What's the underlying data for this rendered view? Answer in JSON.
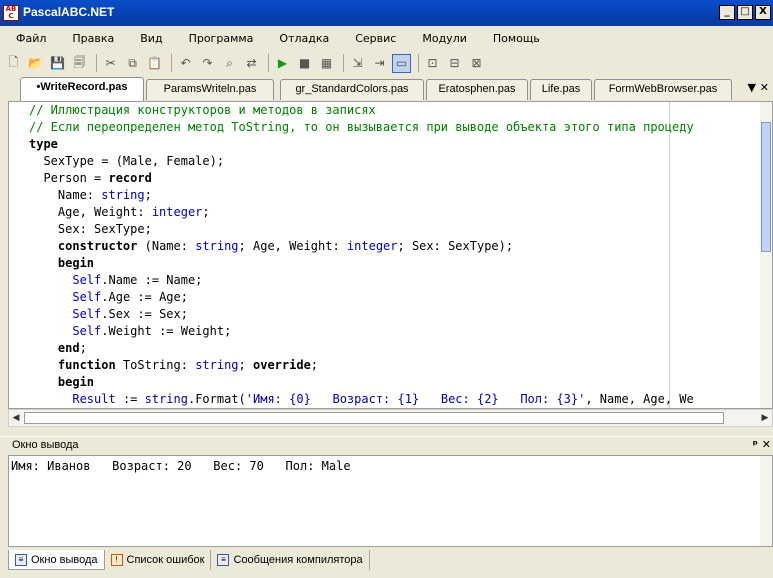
{
  "window": {
    "title": "PascalABC.NET",
    "icon_text": "AB\nC",
    "min": "_",
    "max": "□",
    "close": "X"
  },
  "menu": [
    "Файл",
    "Правка",
    "Вид",
    "Программа",
    "Отладка",
    "Сервис",
    "Модули",
    "Помощь"
  ],
  "toolbar_icons": [
    "new-file-icon",
    "open-folder-icon",
    "save-icon",
    "save-all-icon",
    "cut-icon",
    "copy-icon",
    "paste-icon",
    "undo-icon",
    "redo-icon",
    "find-icon",
    "replace-icon",
    "run-icon",
    "stop-icon",
    "compile-icon",
    "debug-step-icon",
    "debug-next-icon",
    "console-icon",
    "form-icon",
    "format-icon",
    "read-icon"
  ],
  "tabs": [
    {
      "label": "•WriteRecord.pas",
      "active": true
    },
    {
      "label": "ParamsWriteln.pas",
      "active": false
    },
    {
      "label": "gr_StandardColors.pas",
      "active": false
    },
    {
      "label": "Eratosphen.pas",
      "active": false
    },
    {
      "label": "Life.pas",
      "active": false
    },
    {
      "label": "FormWebBrowser.pas",
      "active": false
    }
  ],
  "tab_controls": "▼ ✕",
  "code": [
    [
      {
        "t": "// Иллюстрация конструкторов и методов в записях",
        "c": "com"
      }
    ],
    [
      {
        "t": "// Если переопределен метод ToString, то он вызывается при выводе объекта этого типа процеду",
        "c": "com"
      }
    ],
    [
      {
        "t": "type",
        "c": "kw"
      }
    ],
    [
      {
        "t": "  SexType = (Male, Female);",
        "c": ""
      }
    ],
    [
      {
        "t": "  Person = ",
        "c": ""
      },
      {
        "t": "record",
        "c": "kw"
      }
    ],
    [
      {
        "t": "    Name: ",
        "c": ""
      },
      {
        "t": "string",
        "c": "type"
      },
      {
        "t": ";",
        "c": ""
      }
    ],
    [
      {
        "t": "    Age, Weight: ",
        "c": ""
      },
      {
        "t": "integer",
        "c": "type"
      },
      {
        "t": ";",
        "c": ""
      }
    ],
    [
      {
        "t": "    Sex: SexType;",
        "c": ""
      }
    ],
    [
      {
        "t": "    ",
        "c": ""
      },
      {
        "t": "constructor",
        "c": "kw"
      },
      {
        "t": " (Name: ",
        "c": ""
      },
      {
        "t": "string",
        "c": "type"
      },
      {
        "t": "; Age, Weight: ",
        "c": ""
      },
      {
        "t": "integer",
        "c": "type"
      },
      {
        "t": "; Sex: SexType);",
        "c": ""
      }
    ],
    [
      {
        "t": "    ",
        "c": ""
      },
      {
        "t": "begin",
        "c": "kw"
      }
    ],
    [
      {
        "t": "      ",
        "c": ""
      },
      {
        "t": "Self",
        "c": "type"
      },
      {
        "t": ".Name := Name;",
        "c": ""
      }
    ],
    [
      {
        "t": "      ",
        "c": ""
      },
      {
        "t": "Self",
        "c": "type"
      },
      {
        "t": ".Age := Age;",
        "c": ""
      }
    ],
    [
      {
        "t": "      ",
        "c": ""
      },
      {
        "t": "Self",
        "c": "type"
      },
      {
        "t": ".Sex := Sex;",
        "c": ""
      }
    ],
    [
      {
        "t": "      ",
        "c": ""
      },
      {
        "t": "Self",
        "c": "type"
      },
      {
        "t": ".Weight := Weight;",
        "c": ""
      }
    ],
    [
      {
        "t": "    ",
        "c": ""
      },
      {
        "t": "end",
        "c": "kw"
      },
      {
        "t": ";",
        "c": ""
      }
    ],
    [
      {
        "t": "    ",
        "c": ""
      },
      {
        "t": "function",
        "c": "kw"
      },
      {
        "t": " ToString: ",
        "c": ""
      },
      {
        "t": "string",
        "c": "type"
      },
      {
        "t": "; ",
        "c": ""
      },
      {
        "t": "override",
        "c": "kw"
      },
      {
        "t": ";",
        "c": ""
      }
    ],
    [
      {
        "t": "    ",
        "c": ""
      },
      {
        "t": "begin",
        "c": "kw"
      }
    ],
    [
      {
        "t": "      ",
        "c": ""
      },
      {
        "t": "Result",
        "c": "type"
      },
      {
        "t": " := ",
        "c": ""
      },
      {
        "t": "string",
        "c": "type"
      },
      {
        "t": ".Format(",
        "c": ""
      },
      {
        "t": "'Имя: {0}   Возраст: {1}   Вес: {2}   Пол: {3}'",
        "c": "str"
      },
      {
        "t": ", Name, Age, We",
        "c": ""
      }
    ]
  ],
  "output_panel": {
    "title": "Окно вывода",
    "controls": "ᵖ ✕",
    "text": "Имя: Иванов   Возраст: 20   Вес: 70   Пол: Male"
  },
  "bottom_tabs": [
    {
      "label": "Окно вывода",
      "active": true,
      "icon": "output-window-icon"
    },
    {
      "label": "Список ошибок",
      "active": false,
      "icon": "error-list-icon"
    },
    {
      "label": "Сообщения компилятора",
      "active": false,
      "icon": "compiler-messages-icon"
    }
  ]
}
